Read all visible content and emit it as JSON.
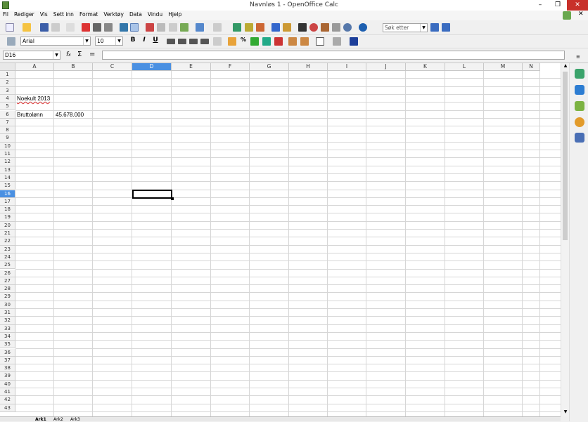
{
  "window": {
    "title": "Navnløs 1 - OpenOffice Calc",
    "minimize": "–",
    "maximize": "❐",
    "close": "✕"
  },
  "menu": [
    "Fil",
    "Rediger",
    "Vis",
    "Sett inn",
    "Format",
    "Verktøy",
    "Data",
    "Vindu",
    "Hjelp"
  ],
  "toolbar": {
    "search_placeholder": "Søk etter",
    "font_name": "Arial",
    "font_size": "10",
    "bold": "B",
    "italic": "I",
    "underline": "U",
    "percent": "%"
  },
  "formula_bar": {
    "name_box": "D16",
    "content": ""
  },
  "columns": [
    "A",
    "B",
    "C",
    "D",
    "E",
    "F",
    "G",
    "H",
    "I",
    "J",
    "K",
    "L",
    "M",
    "N"
  ],
  "selected_column": "D",
  "selected_row": 16,
  "row_count": 43,
  "cells": {
    "A4": "Noekult 2013",
    "A6": "Bruttolønn",
    "B6": "45.678.000"
  },
  "sheet_tabs": [
    "Ark1",
    "Ark2",
    "Ark3"
  ],
  "colors": {
    "selection_header": "#4a90e2",
    "close_button": "#c8302a"
  }
}
